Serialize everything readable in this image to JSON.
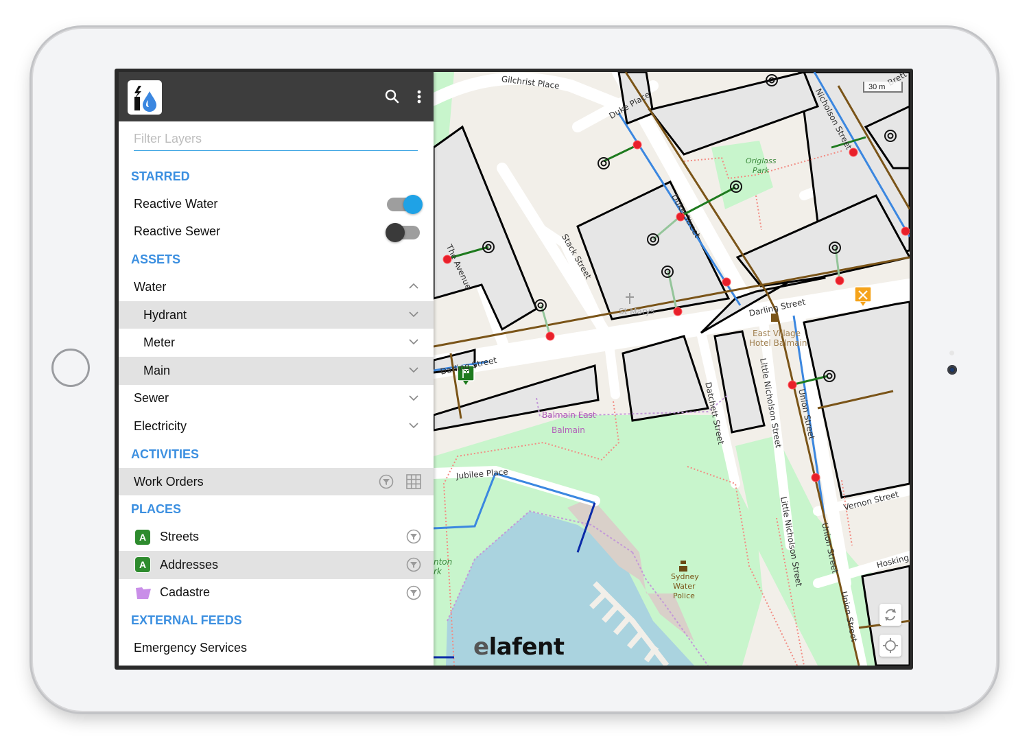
{
  "app": {
    "logo_icon": "lightning-water-drop-logo",
    "search_icon": "search-icon",
    "menu_icon": "more-vert-icon",
    "filter": {
      "placeholder": "Filter Layers",
      "value": ""
    }
  },
  "sidebar": {
    "sections": {
      "starred": "STARRED",
      "assets": "ASSETS",
      "activities": "ACTIVITIES",
      "places": "PLACES",
      "external_feeds": "EXTERNAL FEEDS"
    },
    "starred": [
      {
        "label": "Reactive Water",
        "enabled": true
      },
      {
        "label": "Reactive Sewer",
        "enabled": false
      }
    ],
    "assets": [
      {
        "label": "Water",
        "expanded": true,
        "children": [
          {
            "label": "Hydrant"
          },
          {
            "label": "Meter"
          },
          {
            "label": "Main"
          }
        ]
      },
      {
        "label": "Sewer",
        "expanded": false
      },
      {
        "label": "Electricity",
        "expanded": false
      }
    ],
    "activities": [
      {
        "label": "Work Orders",
        "icons": [
          "filter-icon",
          "grid-icon"
        ]
      }
    ],
    "places": [
      {
        "label": "Streets",
        "badge": "A",
        "icon": "filter-icon"
      },
      {
        "label": "Addresses",
        "badge": "A",
        "icon": "filter-icon"
      },
      {
        "label": "Cadastre",
        "badge": "",
        "icon": "filter-icon"
      }
    ],
    "external_feeds": [
      {
        "label": "Emergency Services"
      }
    ]
  },
  "map": {
    "scale_label": "30 m",
    "brand_prefix": "e",
    "brand_rest": "lafent",
    "labels": {
      "gilchrist": "Gilchrist Place",
      "duke_place": "Duke Place",
      "nicholson": "Nicholson Street",
      "brett": "Brett",
      "origlass1": "Origlass",
      "origlass2": "Park",
      "duke_street": "Duke Street",
      "stack": "Stack Street",
      "avenue": "The Avenue",
      "darling_e": "Darling Street",
      "darling_w": "Darling Street",
      "marys": "St Marys",
      "east_village1": "East Village",
      "east_village2": "Hotel Balmain",
      "little_nich1": "Little Nicholson Street",
      "little_nich2": "Little Nicholson Street",
      "union1": "Union Street",
      "union2": "Union Street",
      "union3": "Union Street",
      "datchett": "Datchett Street",
      "balmain_east": "Balmain East",
      "balmain": "Balmain",
      "jubilee": "Jubilee Place",
      "vernon": "Vernon Street",
      "hosking": "Hosking",
      "police1": "Sydney",
      "police2": "Water",
      "police3": "Police",
      "park_partial1": "nton",
      "park_partial2": "rk"
    },
    "controls": [
      "refresh-icon",
      "locate-icon"
    ]
  },
  "colors": {
    "accent": "#3b8fe0",
    "toggle_on": "#1fa2e6",
    "topbar": "#3d3d3d",
    "water_main": "#3b87e0",
    "sewer_main": "#7a5418",
    "service_line": "#1e7a1e",
    "hydrant": "#e8202a",
    "park": "#c8f5cc",
    "water": "#aad3df",
    "parcel_fill": "#e6e6e6"
  }
}
